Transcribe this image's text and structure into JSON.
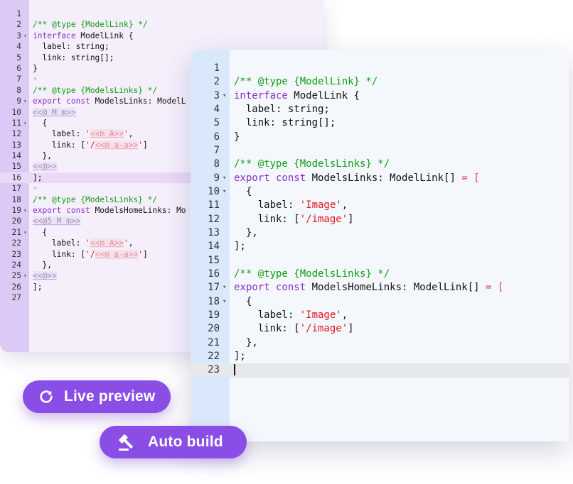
{
  "back_editor": {
    "active_line": 16,
    "lines": [
      {
        "n": "1",
        "fold": false,
        "tokens": []
      },
      {
        "n": "2",
        "fold": false,
        "tokens": [
          {
            "t": "/** @type {ModelLink} */",
            "c": "comment"
          }
        ]
      },
      {
        "n": "3",
        "fold": true,
        "tokens": [
          {
            "t": "interface",
            "c": "kw"
          },
          {
            "t": " ModelLink {"
          }
        ]
      },
      {
        "n": "4",
        "fold": false,
        "tokens": [
          {
            "t": "  label: string;"
          }
        ]
      },
      {
        "n": "5",
        "fold": false,
        "tokens": [
          {
            "t": "  link: string[];"
          }
        ]
      },
      {
        "n": "6",
        "fold": false,
        "tokens": [
          {
            "t": "}"
          }
        ]
      },
      {
        "n": "7",
        "fold": false,
        "tokens": [
          {
            "t": "•",
            "c": "dot"
          }
        ]
      },
      {
        "n": "8",
        "fold": false,
        "tokens": [
          {
            "t": "/** @type {ModelsLinks} */",
            "c": "comment"
          }
        ]
      },
      {
        "n": "9",
        "fold": true,
        "tokens": [
          {
            "t": "export const",
            "c": "kw"
          },
          {
            "t": " ModelsLinks: ModelL"
          }
        ]
      },
      {
        "n": "10",
        "fold": false,
        "tokens": [
          {
            "t": "<<@ M m>>",
            "c": "tpl"
          }
        ]
      },
      {
        "n": "11",
        "fold": true,
        "tokens": [
          {
            "t": "  {"
          }
        ]
      },
      {
        "n": "12",
        "fold": false,
        "tokens": [
          {
            "t": "    label: "
          },
          {
            "t": "'",
            "c": "str"
          },
          {
            "t": "<<m A>>",
            "c": "tplstr"
          },
          {
            "t": "'",
            "c": "str"
          },
          {
            "t": ","
          }
        ]
      },
      {
        "n": "13",
        "fold": false,
        "tokens": [
          {
            "t": "    link: ["
          },
          {
            "t": "'/",
            "c": "str"
          },
          {
            "t": "<<m a-a>>",
            "c": "tplstr"
          },
          {
            "t": "'",
            "c": "str"
          },
          {
            "t": "]"
          }
        ]
      },
      {
        "n": "14",
        "fold": false,
        "tokens": [
          {
            "t": "  },"
          }
        ]
      },
      {
        "n": "15",
        "fold": false,
        "tokens": [
          {
            "t": "<<@>>",
            "c": "tpl"
          }
        ]
      },
      {
        "n": "16",
        "fold": false,
        "tokens": [
          {
            "t": "];"
          }
        ]
      },
      {
        "n": "17",
        "fold": false,
        "tokens": [
          {
            "t": "•",
            "c": "dot"
          }
        ]
      },
      {
        "n": "18",
        "fold": false,
        "tokens": [
          {
            "t": "/** @type {ModelsLinks} */",
            "c": "comment"
          }
        ]
      },
      {
        "n": "19",
        "fold": true,
        "tokens": [
          {
            "t": "export const",
            "c": "kw"
          },
          {
            "t": " ModelsHomeLinks: Mo"
          }
        ]
      },
      {
        "n": "20",
        "fold": false,
        "tokens": [
          {
            "t": "<<@5 M m>>",
            "c": "tpl"
          }
        ]
      },
      {
        "n": "21",
        "fold": true,
        "tokens": [
          {
            "t": "  {"
          }
        ]
      },
      {
        "n": "22",
        "fold": false,
        "tokens": [
          {
            "t": "    label: "
          },
          {
            "t": "'",
            "c": "str"
          },
          {
            "t": "<<m A>>",
            "c": "tplstr"
          },
          {
            "t": "'",
            "c": "str"
          },
          {
            "t": ","
          }
        ]
      },
      {
        "n": "23",
        "fold": false,
        "tokens": [
          {
            "t": "    link: ["
          },
          {
            "t": "'/",
            "c": "str"
          },
          {
            "t": "<<m a-a>>",
            "c": "tplstr"
          },
          {
            "t": "'",
            "c": "str"
          },
          {
            "t": "]"
          }
        ]
      },
      {
        "n": "24",
        "fold": false,
        "tokens": [
          {
            "t": "  },"
          }
        ]
      },
      {
        "n": "25",
        "fold": true,
        "tokens": [
          {
            "t": "<<@>>",
            "c": "tpl"
          }
        ]
      },
      {
        "n": "26",
        "fold": false,
        "tokens": [
          {
            "t": "];"
          }
        ]
      },
      {
        "n": "27",
        "fold": false,
        "tokens": []
      }
    ]
  },
  "front_editor": {
    "active_line": 23,
    "lines": [
      {
        "n": "1",
        "fold": false,
        "tokens": []
      },
      {
        "n": "2",
        "fold": false,
        "tokens": [
          {
            "t": "/** @type {ModelLink} */",
            "c": "comment"
          }
        ]
      },
      {
        "n": "3",
        "fold": true,
        "tokens": [
          {
            "t": "interface",
            "c": "kw"
          },
          {
            "t": " ModelLink {"
          }
        ]
      },
      {
        "n": "4",
        "fold": false,
        "tokens": [
          {
            "t": "  label: string;"
          }
        ]
      },
      {
        "n": "5",
        "fold": false,
        "tokens": [
          {
            "t": "  link: string[];"
          }
        ]
      },
      {
        "n": "6",
        "fold": false,
        "tokens": [
          {
            "t": "}"
          }
        ]
      },
      {
        "n": "7",
        "fold": false,
        "tokens": []
      },
      {
        "n": "8",
        "fold": false,
        "tokens": [
          {
            "t": "/** @type {ModelsLinks} */",
            "c": "comment"
          }
        ]
      },
      {
        "n": "9",
        "fold": true,
        "tokens": [
          {
            "t": "export const",
            "c": "kw"
          },
          {
            "t": " ModelsLinks: ModelLink[] "
          },
          {
            "t": "= [",
            "c": "op"
          }
        ]
      },
      {
        "n": "10",
        "fold": true,
        "tokens": [
          {
            "t": "  {"
          }
        ]
      },
      {
        "n": "11",
        "fold": false,
        "tokens": [
          {
            "t": "    label: "
          },
          {
            "t": "'Image'",
            "c": "str"
          },
          {
            "t": ","
          }
        ]
      },
      {
        "n": "12",
        "fold": false,
        "tokens": [
          {
            "t": "    link: ["
          },
          {
            "t": "'/image'",
            "c": "str"
          },
          {
            "t": "]"
          }
        ]
      },
      {
        "n": "13",
        "fold": false,
        "tokens": [
          {
            "t": "  },"
          }
        ]
      },
      {
        "n": "14",
        "fold": false,
        "tokens": [
          {
            "t": "];"
          }
        ]
      },
      {
        "n": "15",
        "fold": false,
        "tokens": []
      },
      {
        "n": "16",
        "fold": false,
        "tokens": [
          {
            "t": "/** @type {ModelsLinks} */",
            "c": "comment"
          }
        ]
      },
      {
        "n": "17",
        "fold": true,
        "tokens": [
          {
            "t": "export const",
            "c": "kw"
          },
          {
            "t": " ModelsHomeLinks: ModelLink[] "
          },
          {
            "t": "= [",
            "c": "op"
          }
        ]
      },
      {
        "n": "18",
        "fold": true,
        "tokens": [
          {
            "t": "  {"
          }
        ]
      },
      {
        "n": "19",
        "fold": false,
        "tokens": [
          {
            "t": "    label: "
          },
          {
            "t": "'Image'",
            "c": "str"
          },
          {
            "t": ","
          }
        ]
      },
      {
        "n": "20",
        "fold": false,
        "tokens": [
          {
            "t": "    link: ["
          },
          {
            "t": "'/image'",
            "c": "str"
          },
          {
            "t": "]"
          }
        ]
      },
      {
        "n": "21",
        "fold": false,
        "tokens": [
          {
            "t": "  },"
          }
        ]
      },
      {
        "n": "22",
        "fold": false,
        "tokens": [
          {
            "t": "];"
          }
        ]
      },
      {
        "n": "23",
        "fold": false,
        "tokens": [],
        "caret": true
      }
    ]
  },
  "buttons": {
    "live_preview": {
      "label": "Live preview",
      "icon": "refresh-icon"
    },
    "auto_build": {
      "label": "Auto build",
      "icon": "hammer-icon"
    }
  },
  "colors": {
    "accent": "#8a4ee6",
    "comment": "#119d11",
    "keyword": "#8a2dc8",
    "string": "#e0131d",
    "back_gutter": "#ddc9f6",
    "front_gutter": "#d9e9fb"
  }
}
